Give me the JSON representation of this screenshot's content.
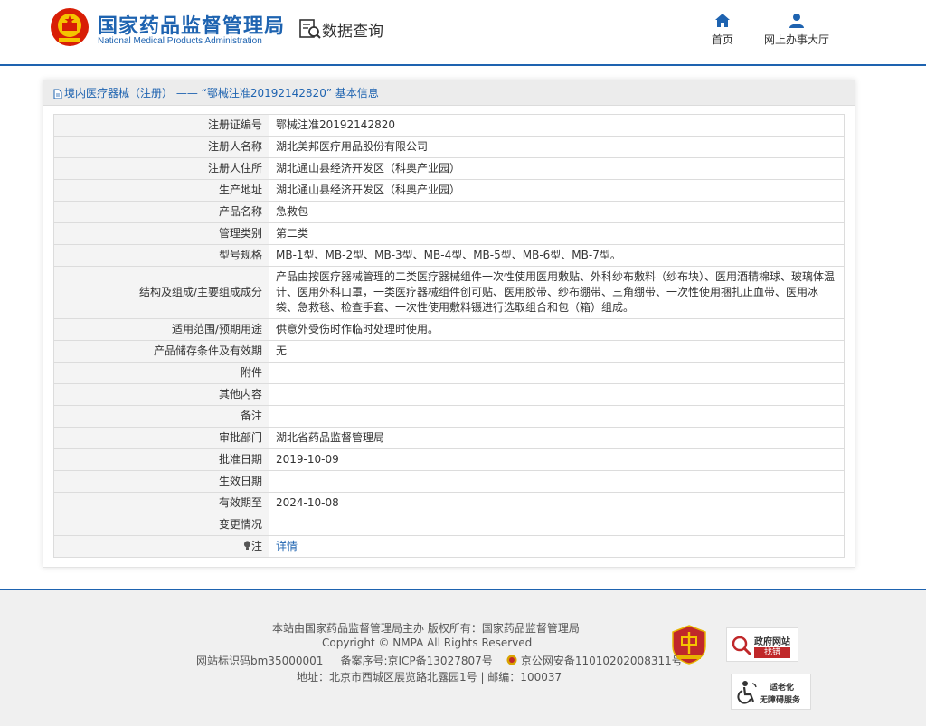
{
  "header": {
    "logo_cn": "国家药品监督管理局",
    "logo_en": "National Medical Products Administration",
    "query_label": "数据查询",
    "nav": [
      {
        "label": "首页",
        "icon": "home-icon"
      },
      {
        "label": "网上办事大厅",
        "icon": "user-icon"
      }
    ]
  },
  "panel": {
    "breadcrumb": "境内医疗器械（注册） —— “鄂械注准20192142820” 基本信息",
    "rows": [
      {
        "key": "注册证编号",
        "value": "鄂械注准20192142820"
      },
      {
        "key": "注册人名称",
        "value": "湖北美邦医疗用品股份有限公司"
      },
      {
        "key": "注册人住所",
        "value": "湖北通山县经济开发区（科奥产业园）"
      },
      {
        "key": "生产地址",
        "value": "湖北通山县经济开发区（科奥产业园）"
      },
      {
        "key": "产品名称",
        "value": "急救包"
      },
      {
        "key": "管理类别",
        "value": "第二类"
      },
      {
        "key": "型号规格",
        "value": "MB-1型、MB-2型、MB-3型、MB-4型、MB-5型、MB-6型、MB-7型。"
      },
      {
        "key": "结构及组成/主要组成成分",
        "value": "产品由按医疗器械管理的二类医疗器械组件一次性使用医用敷贴、外科纱布敷料（纱布块）、医用酒精棉球、玻璃体温计、医用外科口罩，一类医疗器械组件创可贴、医用胶带、纱布绷带、三角绷带、一次性使用捆扎止血带、医用冰袋、急救毯、检查手套、一次性使用敷料镊进行选取组合和包（箱）组成。"
      },
      {
        "key": "适用范围/预期用途",
        "value": "供意外受伤时作临时处理时使用。"
      },
      {
        "key": "产品储存条件及有效期",
        "value": "无"
      },
      {
        "key": "附件",
        "value": ""
      },
      {
        "key": "其他内容",
        "value": ""
      },
      {
        "key": "备注",
        "value": ""
      },
      {
        "key": "审批部门",
        "value": "湖北省药品监督管理局"
      },
      {
        "key": "批准日期",
        "value": "2019-10-09"
      },
      {
        "key": "生效日期",
        "value": ""
      },
      {
        "key": "有效期至",
        "value": "2024-10-08"
      },
      {
        "key": "变更情况",
        "value": ""
      }
    ],
    "note_key": "注",
    "note_link": "详情"
  },
  "footer": {
    "line1": "本站由国家药品监督管理局主办 版权所有：国家药品监督管理局",
    "line2": "Copyright © NMPA All Rights Reserved",
    "line3_a": "网站标识码bm35000001",
    "line3_b": "备案序号:京ICP备13027807号",
    "line3_c": "京公网安备11010202008311号",
    "line4": "地址：北京市西城区展览路北露园1号 | 邮编：100037",
    "badge_zhaocuo_title": "政府网站",
    "badge_zhaocuo_sub": "找错",
    "badge_aged_title": "适老化",
    "badge_aged_sub": "无障碍服务"
  },
  "colors": {
    "brand_blue": "#1e63b0",
    "error_red": "#c0282a"
  }
}
